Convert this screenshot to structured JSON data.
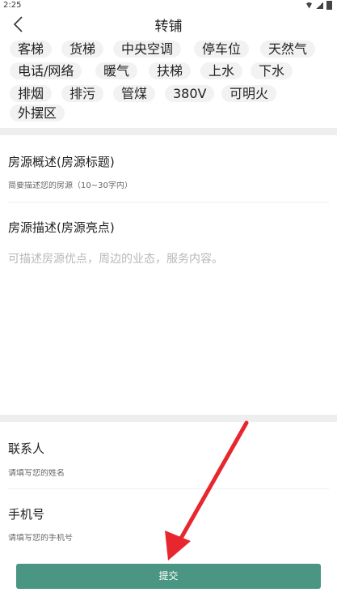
{
  "status_bar": {
    "time": "2:25"
  },
  "header": {
    "title": "转铺"
  },
  "tags": [
    "客梯",
    "货梯",
    "中央空调",
    "停车位",
    "天然气",
    "电话/网络",
    "暖气",
    "扶梯",
    "上水",
    "下水",
    "排烟",
    "排污",
    "管煤",
    "380V",
    "可明火",
    "外摆区"
  ],
  "form": {
    "title_label": "房源概述(房源标题)",
    "title_placeholder": "简要描述您的房源（10~30字内）",
    "desc_label": "房源描述(房源亮点)",
    "desc_placeholder": "可描述房源优点，周边的业态，服务内容。",
    "contact_label": "联系人",
    "contact_placeholder": "请填写您的姓名",
    "phone_label": "手机号",
    "phone_placeholder": "请填写您的手机号"
  },
  "submit_label": "提交",
  "colors": {
    "accent": "#4b9683",
    "annotation_arrow": "#e8262d"
  }
}
